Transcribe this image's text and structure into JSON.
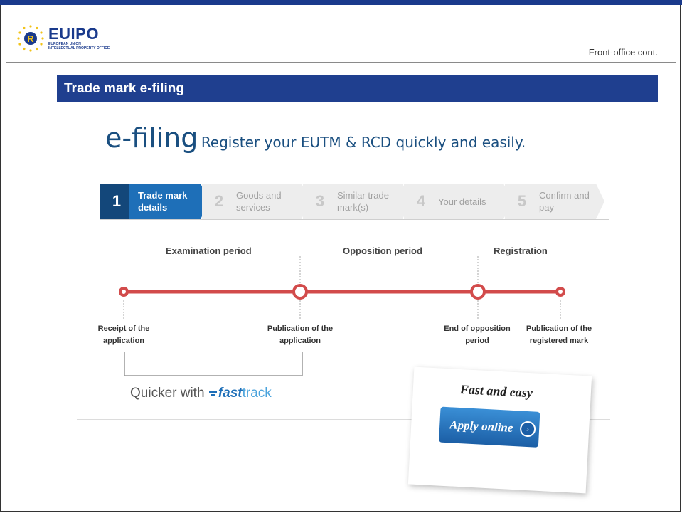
{
  "header": {
    "logo_main": "EUIPO",
    "logo_sub_1": "EUROPEAN UNION",
    "logo_sub_2": "INTELLECTUAL PROPERTY OFFICE",
    "right_label": "Front-office cont."
  },
  "title_bar": "Trade mark e-filing",
  "efiling": {
    "big": "e-filing",
    "tagline": "Register your EUTM & RCD quickly and easily."
  },
  "steps": [
    {
      "num": "1",
      "label1": "Trade mark",
      "label2": "details",
      "active": true
    },
    {
      "num": "2",
      "label1": "Goods and",
      "label2": "services",
      "active": false
    },
    {
      "num": "3",
      "label1": "Similar trade",
      "label2": "mark(s)",
      "active": false
    },
    {
      "num": "4",
      "label1": "Your details",
      "label2": "",
      "active": false
    },
    {
      "num": "5",
      "label1": "Confirm and",
      "label2": "pay",
      "active": false
    }
  ],
  "periods": {
    "examination": "Examination period",
    "opposition": "Opposition period",
    "registration": "Registration"
  },
  "milestones": {
    "receipt_1": "Receipt of the",
    "receipt_2": "application",
    "publication_1": "Publication of the",
    "publication_2": "application",
    "end_opp_1": "End of opposition",
    "end_opp_2": "period",
    "pub_reg_1": "Publication of the",
    "pub_reg_2": "registered mark"
  },
  "quicker": {
    "prefix": "Quicker with",
    "fast": "fast",
    "track": "track"
  },
  "card": {
    "title": "Fast and easy",
    "button": "Apply online",
    "arrow": "›"
  },
  "colors": {
    "brand_blue": "#1f3f8f",
    "step_active": "#1e6fb8",
    "timeline_red": "#d24b4b"
  }
}
